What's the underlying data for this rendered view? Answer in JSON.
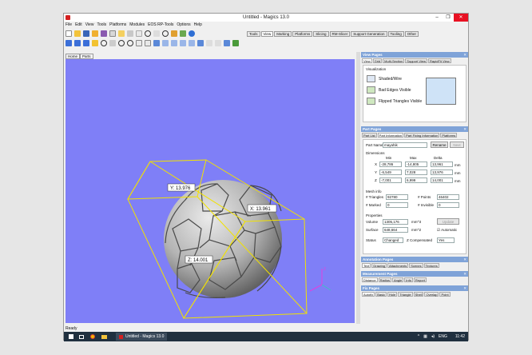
{
  "window": {
    "title": "Untitled - Magics 13.0",
    "minimize": "–",
    "restore": "❐",
    "close": "✕"
  },
  "menu": [
    "File",
    "Edit",
    "View",
    "Tools",
    "Platforms",
    "Modules",
    "EOS RP-Tools",
    "Options",
    "Help"
  ],
  "toolbar_tabs": [
    "Tools",
    "View",
    "Marking",
    "Platforms",
    "Slicing",
    "RM-Slicer",
    "Support Generation",
    "Tooling",
    "Other"
  ],
  "toolbar_active_tab": "View",
  "view_tabs": [
    "Home",
    "Parts"
  ],
  "viewport": {
    "background": "#7f7ff7",
    "bbox_color": "#f2e200",
    "labels": {
      "y": "Y: 13.976",
      "x": "X: 13.961",
      "z": "Z: 14.001"
    },
    "axis_z": "z"
  },
  "view_pages": {
    "header": "View Pages",
    "tabs": [
      "View",
      "Grid",
      "Multi-Section",
      "Support View",
      "RapidFit View"
    ],
    "active_tab": "View",
    "section": "Visualization",
    "options": [
      "Shaded/Wire",
      "Bad Edges Visible",
      "Flipped Triangles Visible"
    ]
  },
  "part_pages": {
    "header": "Part Pages",
    "tabs": [
      "Part List",
      "Part Information",
      "Part Fixing Information",
      "Platforms"
    ],
    "active_tab": "Part Information",
    "part_name_label": "Part Name",
    "part_name_value": "mayahik",
    "rename_label": "Rename",
    "next_label": "Next",
    "dimensions_label": "Dimensions",
    "dim_headers": [
      "Min",
      "Max",
      "Delta"
    ],
    "dims": [
      {
        "axis": "X",
        "min": "-28,786",
        "max": "-14,805",
        "delta": "13,961",
        "unit": "mm"
      },
      {
        "axis": "Y",
        "min": "-6,549",
        "max": "7,028",
        "delta": "13,976",
        "unit": "mm"
      },
      {
        "axis": "Z",
        "min": "-7,001",
        "max": "6,999",
        "delta": "14,001",
        "unit": "mm"
      }
    ],
    "mesh_info_label": "Mesh info",
    "triangles_label": "# Triangles",
    "triangles_value": "92780",
    "points_label": "# Points",
    "points_value": "46402",
    "marked_label": "# Marked",
    "marked_value": "0",
    "invisible_label": "# Invisible",
    "invisible_value": "0",
    "properties_label": "Properties",
    "volume_label": "Volume",
    "volume_value": "1305,176",
    "volume_unit": "mm^3",
    "update_label": "Update",
    "surface_label": "Surface",
    "surface_value": "648,664",
    "surface_unit": "mm^2",
    "automatic_label": "Automatic",
    "status_label": "Status",
    "status_value": "Changed",
    "compensated_label": "Z Compensated",
    "compensated_value": "Yes"
  },
  "annotation_pages": {
    "header": "Annotation Pages",
    "tabs": [
      "Text",
      "Drawing",
      "Attachments",
      "Scenes",
      "Textures"
    ],
    "active_tab": "Text"
  },
  "measurement_pages": {
    "header": "Measurement Pages",
    "tabs": [
      "Distance",
      "Radius",
      "Angle",
      "Info",
      "Report"
    ],
    "active_tab": "Distance"
  },
  "fix_pages": {
    "header": "Fix Pages",
    "tabs": [
      "Autofix",
      "Basic",
      "Hole",
      "Triangle",
      "Shell",
      "Overlap",
      "Point"
    ],
    "active_tab": "Autofix"
  },
  "status_bar": "Ready",
  "taskbar": {
    "app_label": "Untitled - Magics 13.0",
    "lang": "ENG",
    "time": "11:42"
  }
}
